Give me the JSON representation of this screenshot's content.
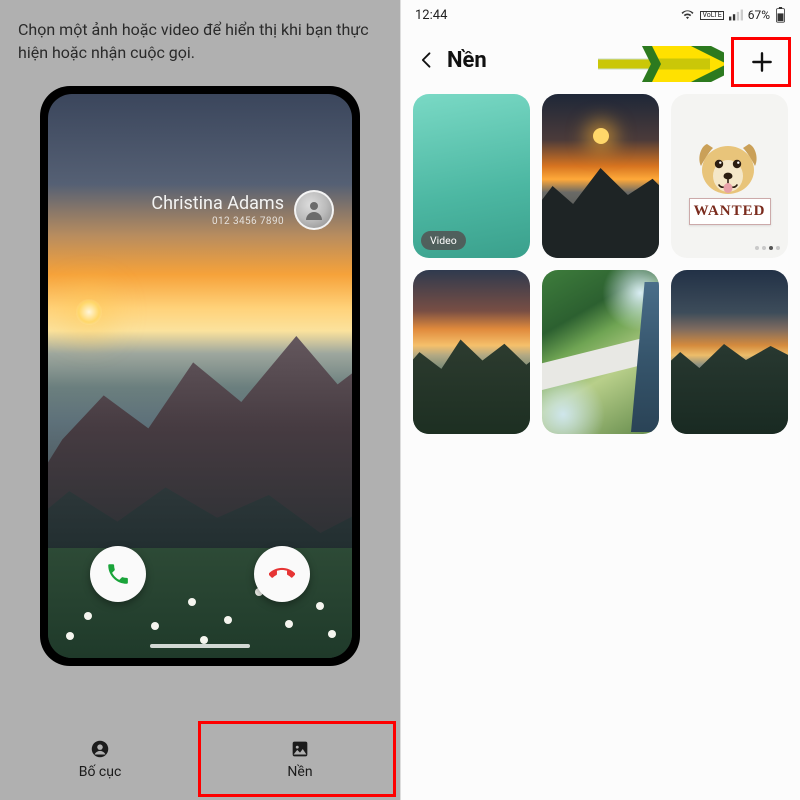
{
  "left": {
    "instruction": "Chọn một ảnh hoặc video để hiển thị khi bạn thực hiện hoặc nhận cuộc gọi.",
    "caller_name": "Christina Adams",
    "caller_number": "012 3456 7890",
    "tabs": {
      "layout": "Bố cục",
      "background": "Nền"
    }
  },
  "right": {
    "status": {
      "time": "12:44",
      "net_label": "VoLTE",
      "battery": "67%"
    },
    "title": "Nền",
    "video_badge": "Video",
    "wanted_sign": "WANTED"
  }
}
